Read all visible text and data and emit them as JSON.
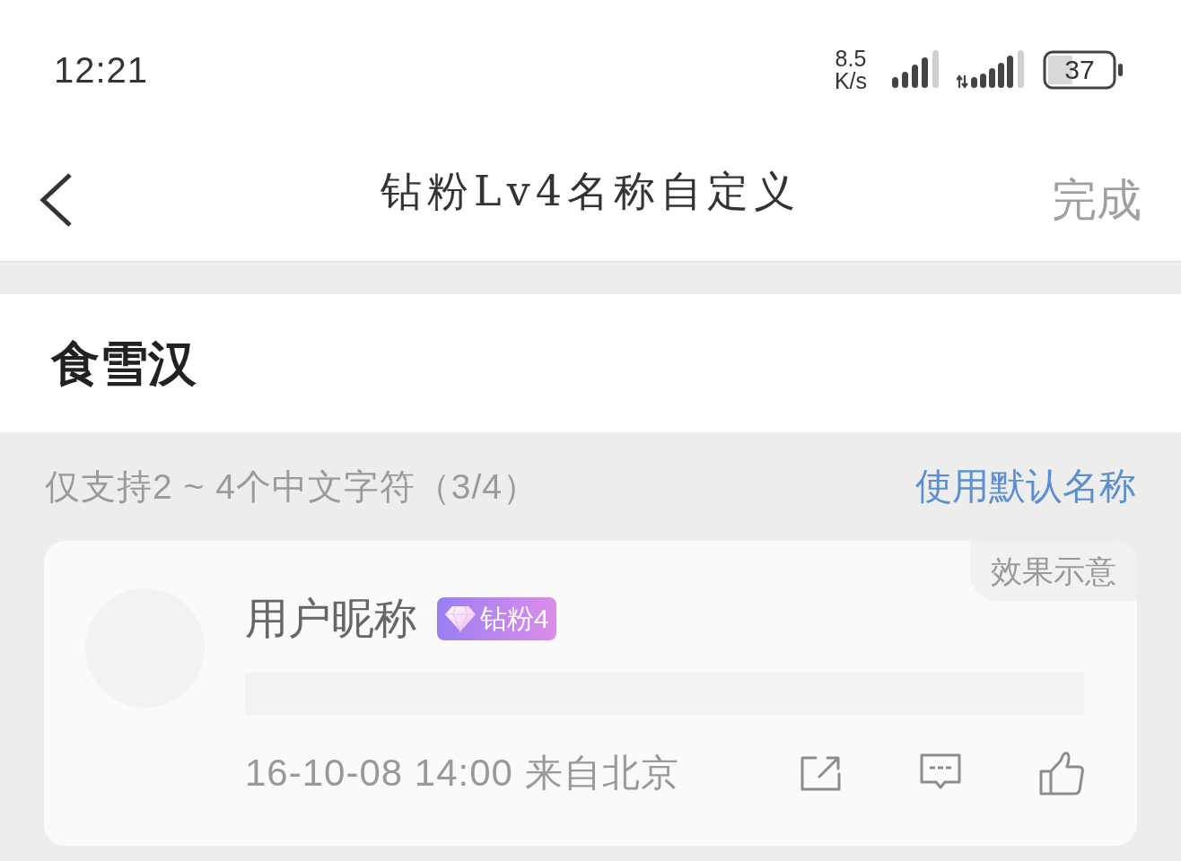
{
  "status_bar": {
    "time": "12:21",
    "net_speed": [
      "8.5",
      "K/s"
    ],
    "battery": "37"
  },
  "nav": {
    "title": "钻粉Lv4名称自定义",
    "done_button": "完成"
  },
  "name_input": {
    "value": "食雪汉"
  },
  "hint": "仅支持2 ~ 4个中文字符（3/4）",
  "default_name_link": "使用默认名称",
  "preview": {
    "tag": "效果示意",
    "nickname": "用户昵称",
    "badge": "钻粉4",
    "meta": "16-10-08 14:00 来自北京"
  }
}
